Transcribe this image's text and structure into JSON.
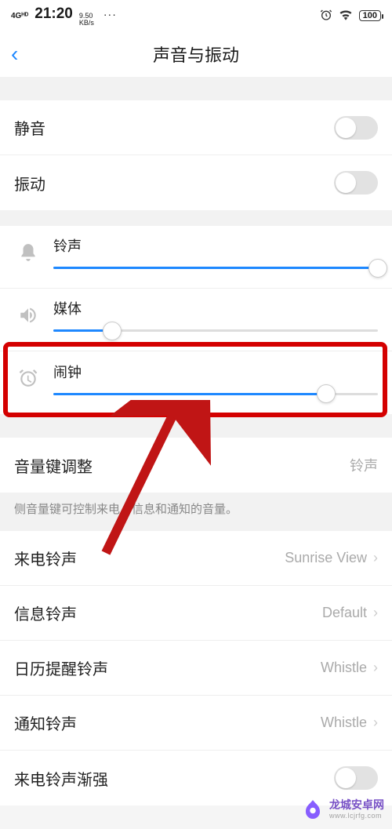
{
  "status": {
    "network": "4Gᴴᴰ",
    "time": "21:20",
    "speed_top": "9.50",
    "speed_bot": "KB/s",
    "dots": "···",
    "alarm_icon": "⏰",
    "wifi_icon": "📶",
    "battery": "100"
  },
  "header": {
    "back": "‹",
    "title": "声音与振动"
  },
  "toggles": {
    "mute": {
      "label": "静音",
      "on": false
    },
    "vibrate": {
      "label": "振动",
      "on": false
    }
  },
  "sliders": {
    "ringtone": {
      "label": "铃声",
      "percent": 100
    },
    "media": {
      "label": "媒体",
      "percent": 18
    },
    "alarm": {
      "label": "闹钟",
      "percent": 84
    }
  },
  "volume_key": {
    "label": "音量键调整",
    "value": "铃声",
    "desc": "侧音量键可控制来电、信息和通知的音量。"
  },
  "ringtones": {
    "incoming": {
      "label": "来电铃声",
      "value": "Sunrise View"
    },
    "message": {
      "label": "信息铃声",
      "value": "Default"
    },
    "calendar": {
      "label": "日历提醒铃声",
      "value": "Whistle"
    },
    "notification": {
      "label": "通知铃声",
      "value": "Whistle"
    },
    "ascending": {
      "label": "来电铃声渐强",
      "on": false
    }
  },
  "watermark": {
    "brand": "龙城安卓网",
    "url": "www.lcjrfg.com"
  }
}
